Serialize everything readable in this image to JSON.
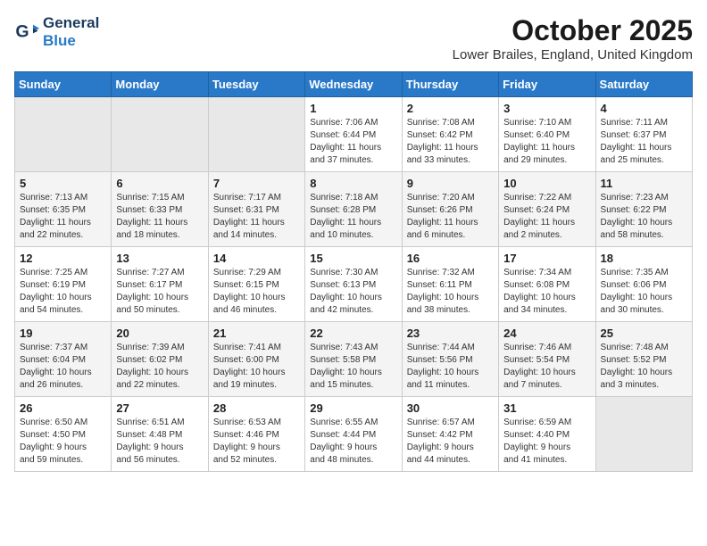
{
  "logo": {
    "line1": "General",
    "line2": "Blue"
  },
  "title": "October 2025",
  "location": "Lower Brailes, England, United Kingdom",
  "weekdays": [
    "Sunday",
    "Monday",
    "Tuesday",
    "Wednesday",
    "Thursday",
    "Friday",
    "Saturday"
  ],
  "weeks": [
    [
      {
        "day": "",
        "info": ""
      },
      {
        "day": "",
        "info": ""
      },
      {
        "day": "",
        "info": ""
      },
      {
        "day": "1",
        "info": "Sunrise: 7:06 AM\nSunset: 6:44 PM\nDaylight: 11 hours\nand 37 minutes."
      },
      {
        "day": "2",
        "info": "Sunrise: 7:08 AM\nSunset: 6:42 PM\nDaylight: 11 hours\nand 33 minutes."
      },
      {
        "day": "3",
        "info": "Sunrise: 7:10 AM\nSunset: 6:40 PM\nDaylight: 11 hours\nand 29 minutes."
      },
      {
        "day": "4",
        "info": "Sunrise: 7:11 AM\nSunset: 6:37 PM\nDaylight: 11 hours\nand 25 minutes."
      }
    ],
    [
      {
        "day": "5",
        "info": "Sunrise: 7:13 AM\nSunset: 6:35 PM\nDaylight: 11 hours\nand 22 minutes."
      },
      {
        "day": "6",
        "info": "Sunrise: 7:15 AM\nSunset: 6:33 PM\nDaylight: 11 hours\nand 18 minutes."
      },
      {
        "day": "7",
        "info": "Sunrise: 7:17 AM\nSunset: 6:31 PM\nDaylight: 11 hours\nand 14 minutes."
      },
      {
        "day": "8",
        "info": "Sunrise: 7:18 AM\nSunset: 6:28 PM\nDaylight: 11 hours\nand 10 minutes."
      },
      {
        "day": "9",
        "info": "Sunrise: 7:20 AM\nSunset: 6:26 PM\nDaylight: 11 hours\nand 6 minutes."
      },
      {
        "day": "10",
        "info": "Sunrise: 7:22 AM\nSunset: 6:24 PM\nDaylight: 11 hours\nand 2 minutes."
      },
      {
        "day": "11",
        "info": "Sunrise: 7:23 AM\nSunset: 6:22 PM\nDaylight: 10 hours\nand 58 minutes."
      }
    ],
    [
      {
        "day": "12",
        "info": "Sunrise: 7:25 AM\nSunset: 6:19 PM\nDaylight: 10 hours\nand 54 minutes."
      },
      {
        "day": "13",
        "info": "Sunrise: 7:27 AM\nSunset: 6:17 PM\nDaylight: 10 hours\nand 50 minutes."
      },
      {
        "day": "14",
        "info": "Sunrise: 7:29 AM\nSunset: 6:15 PM\nDaylight: 10 hours\nand 46 minutes."
      },
      {
        "day": "15",
        "info": "Sunrise: 7:30 AM\nSunset: 6:13 PM\nDaylight: 10 hours\nand 42 minutes."
      },
      {
        "day": "16",
        "info": "Sunrise: 7:32 AM\nSunset: 6:11 PM\nDaylight: 10 hours\nand 38 minutes."
      },
      {
        "day": "17",
        "info": "Sunrise: 7:34 AM\nSunset: 6:08 PM\nDaylight: 10 hours\nand 34 minutes."
      },
      {
        "day": "18",
        "info": "Sunrise: 7:35 AM\nSunset: 6:06 PM\nDaylight: 10 hours\nand 30 minutes."
      }
    ],
    [
      {
        "day": "19",
        "info": "Sunrise: 7:37 AM\nSunset: 6:04 PM\nDaylight: 10 hours\nand 26 minutes."
      },
      {
        "day": "20",
        "info": "Sunrise: 7:39 AM\nSunset: 6:02 PM\nDaylight: 10 hours\nand 22 minutes."
      },
      {
        "day": "21",
        "info": "Sunrise: 7:41 AM\nSunset: 6:00 PM\nDaylight: 10 hours\nand 19 minutes."
      },
      {
        "day": "22",
        "info": "Sunrise: 7:43 AM\nSunset: 5:58 PM\nDaylight: 10 hours\nand 15 minutes."
      },
      {
        "day": "23",
        "info": "Sunrise: 7:44 AM\nSunset: 5:56 PM\nDaylight: 10 hours\nand 11 minutes."
      },
      {
        "day": "24",
        "info": "Sunrise: 7:46 AM\nSunset: 5:54 PM\nDaylight: 10 hours\nand 7 minutes."
      },
      {
        "day": "25",
        "info": "Sunrise: 7:48 AM\nSunset: 5:52 PM\nDaylight: 10 hours\nand 3 minutes."
      }
    ],
    [
      {
        "day": "26",
        "info": "Sunrise: 6:50 AM\nSunset: 4:50 PM\nDaylight: 9 hours\nand 59 minutes."
      },
      {
        "day": "27",
        "info": "Sunrise: 6:51 AM\nSunset: 4:48 PM\nDaylight: 9 hours\nand 56 minutes."
      },
      {
        "day": "28",
        "info": "Sunrise: 6:53 AM\nSunset: 4:46 PM\nDaylight: 9 hours\nand 52 minutes."
      },
      {
        "day": "29",
        "info": "Sunrise: 6:55 AM\nSunset: 4:44 PM\nDaylight: 9 hours\nand 48 minutes."
      },
      {
        "day": "30",
        "info": "Sunrise: 6:57 AM\nSunset: 4:42 PM\nDaylight: 9 hours\nand 44 minutes."
      },
      {
        "day": "31",
        "info": "Sunrise: 6:59 AM\nSunset: 4:40 PM\nDaylight: 9 hours\nand 41 minutes."
      },
      {
        "day": "",
        "info": ""
      }
    ]
  ]
}
